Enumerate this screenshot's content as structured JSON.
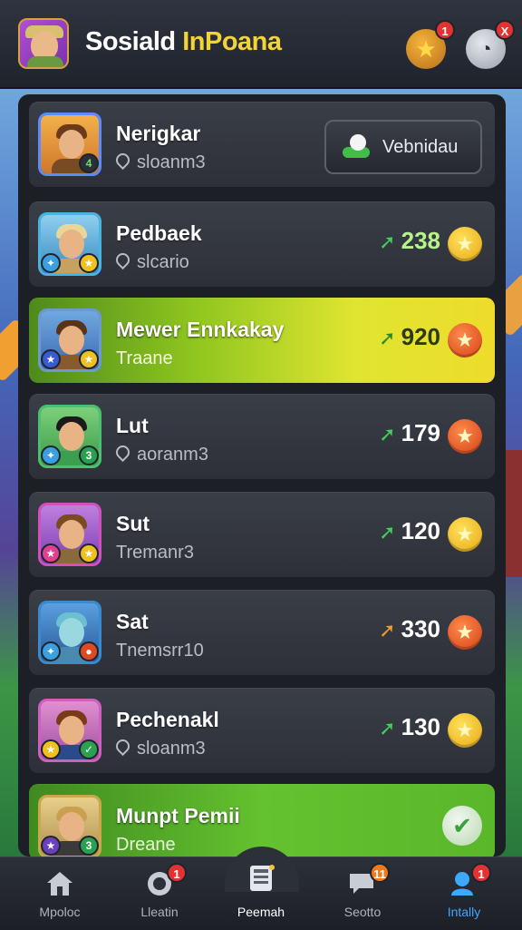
{
  "header": {
    "title_main": "Sosiald ",
    "title_accent": "InPoana",
    "star_badge": "1",
    "chat_badge": "X",
    "star_icon": "star-icon",
    "chat_icon": "chat-icon"
  },
  "rows": [
    {
      "name": "Nerigkar",
      "sub": "sloanm3",
      "action_label": "Vebnidau",
      "type": "action"
    },
    {
      "name": "Pedbaek",
      "sub": "slcario",
      "score": "238",
      "coin": "gold"
    },
    {
      "name": "Mewer Ennkakay",
      "sub": "Traane",
      "score": "920",
      "coin": "red",
      "highlight": "yellow"
    },
    {
      "name": "Lut",
      "sub": "aoranm3",
      "score": "179",
      "coin": "red"
    },
    {
      "name": "Sut",
      "sub": "Tremanr3",
      "score": "120",
      "coin": "gold"
    },
    {
      "name": "Sat",
      "sub": "Tnemsrr10",
      "score": "330",
      "coin": "red"
    },
    {
      "name": "Pechenakl",
      "sub": "sloanm3",
      "score": "130",
      "coin": "gold"
    },
    {
      "name": "Munpt Pemii",
      "sub": "Dreane",
      "highlight": "green",
      "type": "check"
    }
  ],
  "nav": {
    "items": [
      {
        "label": "Mpoloc",
        "icon": "home-icon"
      },
      {
        "label": "Lleatin",
        "icon": "leaderboard-icon",
        "badge": "1"
      },
      {
        "label": "Peemah",
        "icon": "profile-card-icon"
      },
      {
        "label": "Seotto",
        "icon": "chat-icon",
        "badge": "11"
      },
      {
        "label": "Intally",
        "icon": "friends-icon",
        "badge": "1"
      }
    ]
  },
  "colors": {
    "accent": "#f3d437",
    "highlight_yellow": "#dfe530",
    "highlight_green": "#64c12f",
    "score_arrow": "#3fd05a"
  }
}
